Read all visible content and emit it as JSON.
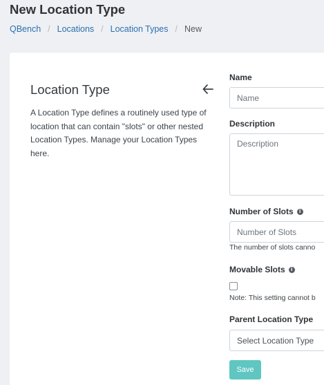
{
  "page": {
    "title": "New Location Type"
  },
  "breadcrumb": {
    "items": [
      "QBench",
      "Locations",
      "Location Types"
    ],
    "current": "New"
  },
  "panel": {
    "title": "Location Type",
    "description": "A Location Type defines a routinely used type of location that can contain \"slots\" or other nested Location Types. Manage your Location Types here."
  },
  "form": {
    "name": {
      "label": "Name",
      "placeholder": "Name"
    },
    "description": {
      "label": "Description",
      "placeholder": "Description"
    },
    "number_of_slots": {
      "label": "Number of Slots",
      "placeholder": "Number of Slots",
      "help": "The number of slots canno"
    },
    "movable_slots": {
      "label": "Movable Slots",
      "checked": false,
      "note": "Note: This setting cannot b"
    },
    "parent_location_type": {
      "label": "Parent Location Type",
      "placeholder": "Select Location Type"
    },
    "save_label": "Save"
  },
  "colors": {
    "background": "#eef0f3",
    "link": "#2c6fb0",
    "save_button": "#5fc6c1"
  },
  "icons": {
    "back": "arrow-left-icon",
    "info": "info-circle-icon"
  }
}
